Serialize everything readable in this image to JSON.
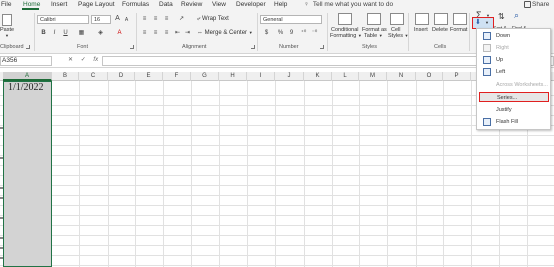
{
  "menu": {
    "items": [
      "File",
      "Home",
      "Insert",
      "Page Layout",
      "Formulas",
      "Data",
      "Review",
      "View",
      "Developer",
      "Help"
    ],
    "active": "Home",
    "tell_me": "Tell me what you want to do",
    "share": "Share"
  },
  "ribbon": {
    "clipboard": {
      "label": "Clipboard",
      "paste": "Paste"
    },
    "font": {
      "label": "Font",
      "font_name": "Calibri",
      "font_size": "16",
      "bold": "B",
      "italic": "I",
      "underline": "U",
      "grow": "A",
      "shrink": "A"
    },
    "alignment": {
      "label": "Alignment",
      "wrap_text": "Wrap Text",
      "merge_center": "Merge & Center"
    },
    "number": {
      "label": "Number",
      "format": "General",
      "currency": "$",
      "percent": "%",
      "comma": "9"
    },
    "styles": {
      "label": "Styles",
      "conditional": [
        "Conditional",
        "Formatting"
      ],
      "format_table": [
        "Format as",
        "Table"
      ],
      "cell_styles": [
        "Cell",
        "Styles"
      ]
    },
    "cells": {
      "label": "Cells",
      "insert": "Insert",
      "delete": "Delete",
      "format": "Format"
    },
    "editing": {
      "sum_icon": "Σ",
      "sort_partial": "Sort &",
      "find_partial": "Find &"
    }
  },
  "formula_bar": {
    "name_box": "A356",
    "cancel": "✕",
    "enter": "✓",
    "fx": "fx",
    "value": ""
  },
  "grid": {
    "columns": [
      "A",
      "B",
      "C",
      "D",
      "E",
      "F",
      "G",
      "H",
      "I",
      "J",
      "K",
      "L",
      "M",
      "N",
      "O",
      "P"
    ],
    "selected_column": "A",
    "cell_a1": "1/1/2022"
  },
  "fill_menu": {
    "items": [
      {
        "label": "Down",
        "enabled": true,
        "icon": "fill-down-icon"
      },
      {
        "label": "Right",
        "enabled": false,
        "icon": "fill-right-icon"
      },
      {
        "label": "Up",
        "enabled": true,
        "icon": "fill-up-icon"
      },
      {
        "label": "Left",
        "enabled": true,
        "icon": "fill-left-icon"
      },
      {
        "label": "Across Worksheets...",
        "enabled": false,
        "icon": ""
      },
      {
        "label": "Series...",
        "enabled": true,
        "highlighted": true,
        "icon": ""
      },
      {
        "label": "Justify",
        "enabled": true,
        "icon": ""
      },
      {
        "label": "Flash Fill",
        "enabled": true,
        "icon": "flash-fill-icon"
      }
    ]
  },
  "colors": {
    "accent": "#1e6b38",
    "selection": "#d3d3d3",
    "highlight_border": "#e02020"
  }
}
